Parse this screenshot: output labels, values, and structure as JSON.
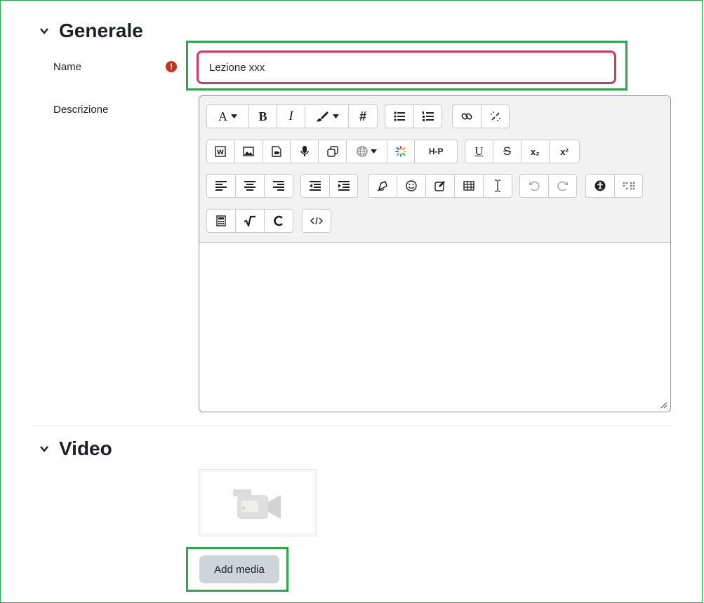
{
  "sections": {
    "general": {
      "title": "Generale"
    },
    "video": {
      "title": "Video"
    }
  },
  "fields": {
    "name": {
      "label": "Name",
      "value": "Lezione xxx",
      "required_icon": "!"
    },
    "description": {
      "label": "Descrizione"
    }
  },
  "toolbar": {
    "row1": {
      "font": "A",
      "bold": "B",
      "italic": "I",
      "hashtag": "#"
    },
    "row2": {
      "h5p": "H-P",
      "underline": "U",
      "strike": "S",
      "subscript": "x₂",
      "superscript": "x²"
    }
  },
  "video": {
    "add_media_label": "Add media"
  },
  "colors": {
    "highlight": "#2ca84a",
    "error_border": "#ca3e5e",
    "required": "#ca3120",
    "button_bg": "#ced4da"
  }
}
